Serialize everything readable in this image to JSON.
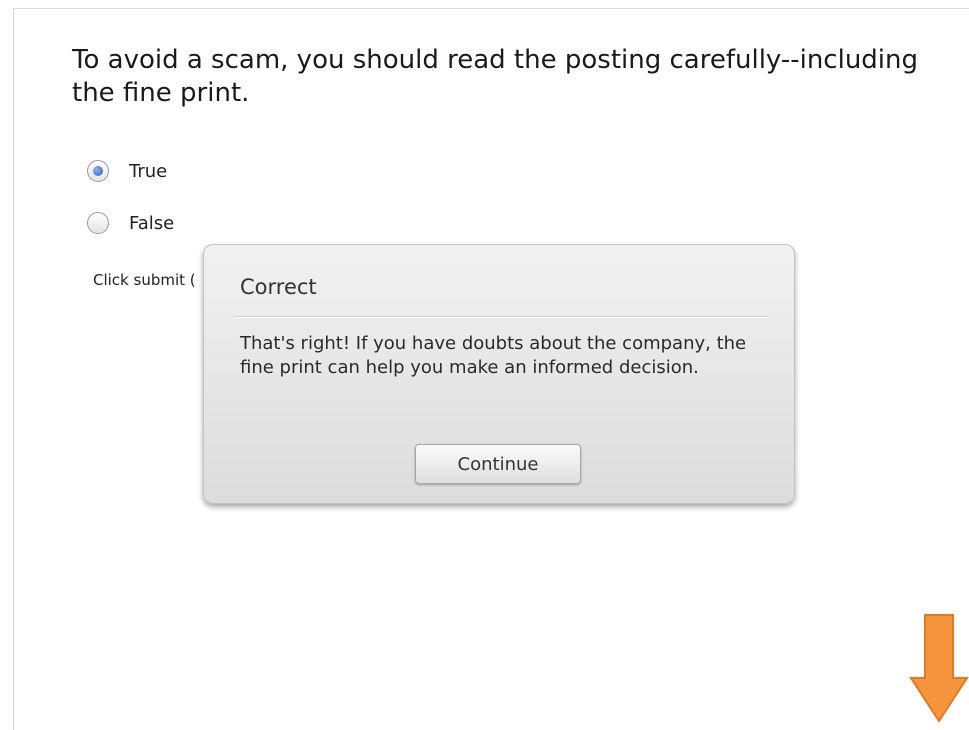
{
  "question": {
    "text": "To avoid a scam, you should read the posting carefully--including the fine print."
  },
  "options": [
    {
      "label": "True",
      "selected": true
    },
    {
      "label": "False",
      "selected": false
    }
  ],
  "hint": "Click submit (",
  "dialog": {
    "title": "Correct",
    "message": "That's right! If you have doubts about the company, the fine print can help you make an informed decision.",
    "button_label": "Continue"
  },
  "colors": {
    "radio_selected": "#2a5bbd",
    "arrow": "#f7953e"
  },
  "icons": {
    "next": "down-arrow-icon"
  }
}
